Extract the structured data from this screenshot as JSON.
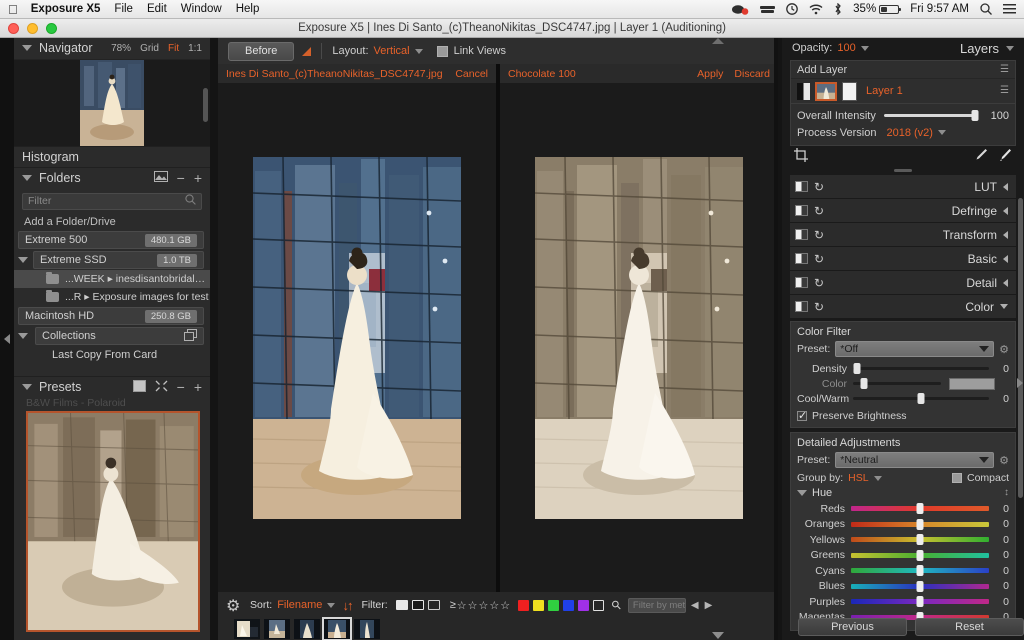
{
  "menubar": {
    "apple_icon": "apple-icon",
    "app_name": "Exposure X5",
    "items": [
      "File",
      "Edit",
      "Window",
      "Help"
    ],
    "status": {
      "battery_percent": "35%",
      "clock": "Fri 9:57 AM",
      "icons": [
        "screen-record-icon",
        "file-transfer-icon",
        "time-machine-icon",
        "wifi-icon",
        "bluetooth-icon",
        "battery-icon",
        "spotlight-search-icon",
        "notification-center-icon"
      ]
    }
  },
  "window": {
    "title": "Exposure X5 | Ines Di Santo_(c)TheanoNikitas_DSC4747.jpg | Layer 1 (Auditioning)",
    "traffic_lights": [
      "close-button",
      "minimize-button",
      "zoom-button"
    ]
  },
  "left_sidebar": {
    "navigator": {
      "title": "Navigator",
      "zoom": "78%",
      "modes": [
        "Grid",
        "Fit",
        "1:1"
      ],
      "active_mode": "Fit"
    },
    "histogram": {
      "title": "Histogram"
    },
    "folders": {
      "title": "Folders",
      "filter_placeholder": "Filter",
      "add_label": "Add a Folder/Drive",
      "drives": [
        {
          "name": "Extreme 500",
          "size": "480.1 GB",
          "expanded": false
        },
        {
          "name": "Extreme SSD",
          "size": "1.0 TB",
          "expanded": true
        }
      ],
      "subfolders": [
        {
          "name": "...WEEK ▸ inesdisantobridalpics",
          "selected": true
        },
        {
          "name": "...R ▸ Exposure images for test",
          "selected": false
        }
      ],
      "drives_2": [
        {
          "name": "Macintosh HD",
          "size": "250.8 GB",
          "expanded": false
        }
      ],
      "collections": {
        "title": "Collections",
        "items": [
          "Last Copy From Card"
        ]
      }
    },
    "presets": {
      "title": "Presets",
      "current_group": "B&W Films - Polaroid"
    }
  },
  "center": {
    "toolbar": {
      "before_label": "Before",
      "layout_label": "Layout:",
      "layout_value": "Vertical",
      "link_views_label": "Link Views",
      "link_views_checked": true
    },
    "left_pane": {
      "title": "Ines Di Santo_(c)TheanoNikitas_DSC4747.jpg",
      "actions": [
        "Cancel"
      ]
    },
    "right_pane": {
      "title": "Chocolate 100",
      "actions": [
        "Apply",
        "Discard"
      ]
    },
    "filmstrip_bar": {
      "settings_icon": "gear-icon",
      "sort_label": "Sort:",
      "sort_value": "Filename",
      "sort_direction_icon": "sort-direction-icon",
      "filter_label": "Filter:",
      "flags": [
        "flag-picked",
        "flag-rejected",
        "flag-unflagged"
      ],
      "rating_prefix": "≥",
      "stars": 5,
      "color_swatches": [
        "#f02020",
        "#f0e020",
        "#30d040",
        "#2040e8",
        "#a030e8",
        "none"
      ],
      "keyword_icon": "keyword-icon",
      "meta_filter_placeholder": "Filter by metadata",
      "nav_prev": "◀",
      "nav_next": "▶"
    },
    "filmstrip_thumbs": [
      {
        "selected": false
      },
      {
        "selected": false
      },
      {
        "selected": false
      },
      {
        "selected": true
      },
      {
        "selected": false
      }
    ]
  },
  "right_sidebar": {
    "layers_header": {
      "opacity_label": "Opacity:",
      "opacity_value": "100",
      "panel_title": "Layers"
    },
    "layers": {
      "add_label": "Add Layer",
      "rows": [
        {
          "name": "Layer 1",
          "selected": true
        }
      ]
    },
    "overall": {
      "intensity_label": "Overall Intensity",
      "intensity_value": "100",
      "process_label": "Process Version",
      "process_value": "2018 (v2)"
    },
    "tools": {
      "crop_icon": "crop-icon",
      "right_icons": [
        "retouch-brush-icon",
        "brush-icon"
      ]
    },
    "sections": [
      {
        "name": "LUT",
        "open": false
      },
      {
        "name": "Defringe",
        "open": false
      },
      {
        "name": "Transform",
        "open": false
      },
      {
        "name": "Basic",
        "open": false
      },
      {
        "name": "Detail",
        "open": false
      },
      {
        "name": "Color",
        "open": true
      }
    ],
    "color_filter": {
      "title": "Color Filter",
      "preset_label": "Preset:",
      "preset_value": "*Off",
      "sliders": [
        {
          "name": "Density",
          "value": "0",
          "knob_pct": 3,
          "dim": false
        },
        {
          "name": "Color",
          "value": "",
          "knob_pct": 12,
          "dim": true,
          "swatch": "#9d9d9d"
        },
        {
          "name": "Cool/Warm",
          "value": "0",
          "knob_pct": 50,
          "dim": false
        }
      ],
      "preserve_brightness_label": "Preserve Brightness",
      "preserve_brightness_checked": true
    },
    "detailed_adjustments": {
      "title": "Detailed Adjustments",
      "preset_label": "Preset:",
      "preset_value": "*Neutral",
      "group_by_label": "Group by:",
      "group_by_value": "HSL",
      "compact_label": "Compact",
      "compact_checked": false,
      "hue_label": "Hue",
      "hsl_rows": [
        {
          "name": "Reds",
          "value": "0",
          "gradient": "linear-gradient(90deg,#c0268c,#e03a2a,#e05a2a)"
        },
        {
          "name": "Oranges",
          "value": "0",
          "gradient": "linear-gradient(90deg,#c02a18,#d8862a,#c8c83a)"
        },
        {
          "name": "Yellows",
          "value": "0",
          "gradient": "linear-gradient(90deg,#c04a1a,#c8c030,#30b030)"
        },
        {
          "name": "Greens",
          "value": "0",
          "gradient": "linear-gradient(90deg,#c8c030,#48b030,#20c0a0)"
        },
        {
          "name": "Cyans",
          "value": "0",
          "gradient": "linear-gradient(90deg,#30a83a,#20b8c0,#2a40c8)"
        },
        {
          "name": "Blues",
          "value": "0",
          "gradient": "linear-gradient(90deg,#18b0b8,#2a30c0,#b02890)"
        },
        {
          "name": "Purples",
          "value": "0",
          "gradient": "linear-gradient(90deg,#1a28b8,#7a28c0,#c02888)"
        },
        {
          "name": "Magentas",
          "value": "0",
          "gradient": "linear-gradient(90deg,#7a20b0,#c02888,#d03a30)"
        }
      ]
    },
    "footer_buttons": {
      "previous": "Previous",
      "reset": "Reset"
    }
  },
  "colors": {
    "accent": "#e8622a",
    "panel_bg": "#2b2b2b",
    "app_bg": "#1a1a1a"
  }
}
